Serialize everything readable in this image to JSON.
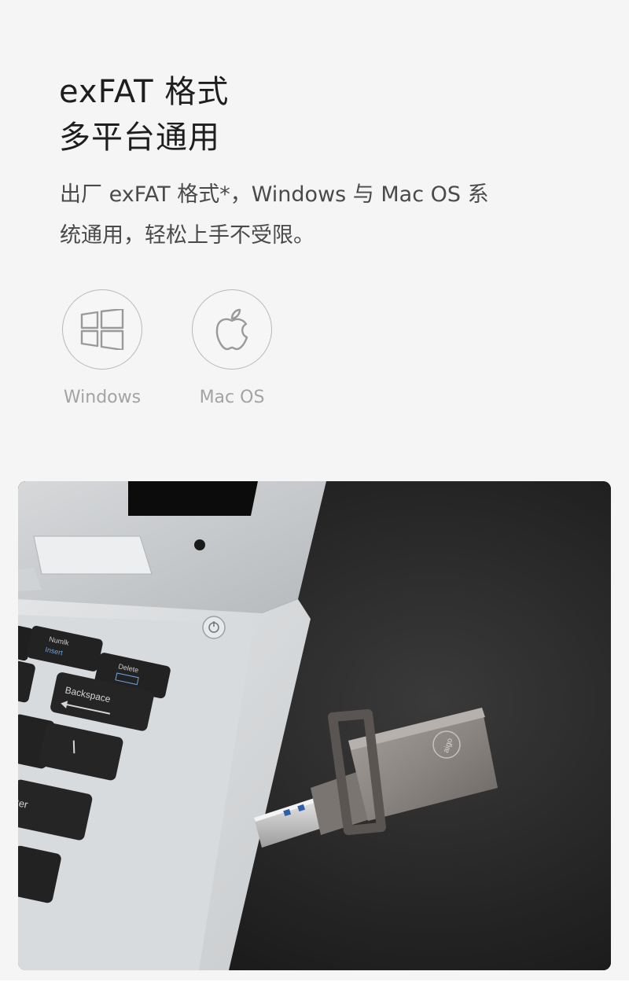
{
  "headline": {
    "line1": "exFAT 格式",
    "line2": "多平台通用"
  },
  "description": {
    "line1": "出厂 exFAT 格式*，Windows 与 Mac OS 系",
    "line2": "统通用，轻松上手不受限。"
  },
  "os_support": [
    {
      "label": "Windows",
      "icon": "windows-icon"
    },
    {
      "label": "Mac OS",
      "icon": "apple-icon"
    }
  ],
  "photo": {
    "keys": {
      "numlk": "Numlk",
      "insert": "Insert",
      "delete": "Delete",
      "backspace": "Backspace",
      "enter": "ter"
    },
    "usb_logo": "aigo"
  },
  "colors": {
    "background": "#f5f5f5",
    "headline_text": "#1e1e1e",
    "body_text": "#4a4a4a",
    "icon_label": "#a3a3a3",
    "photo_background": "#1e1e1e"
  }
}
